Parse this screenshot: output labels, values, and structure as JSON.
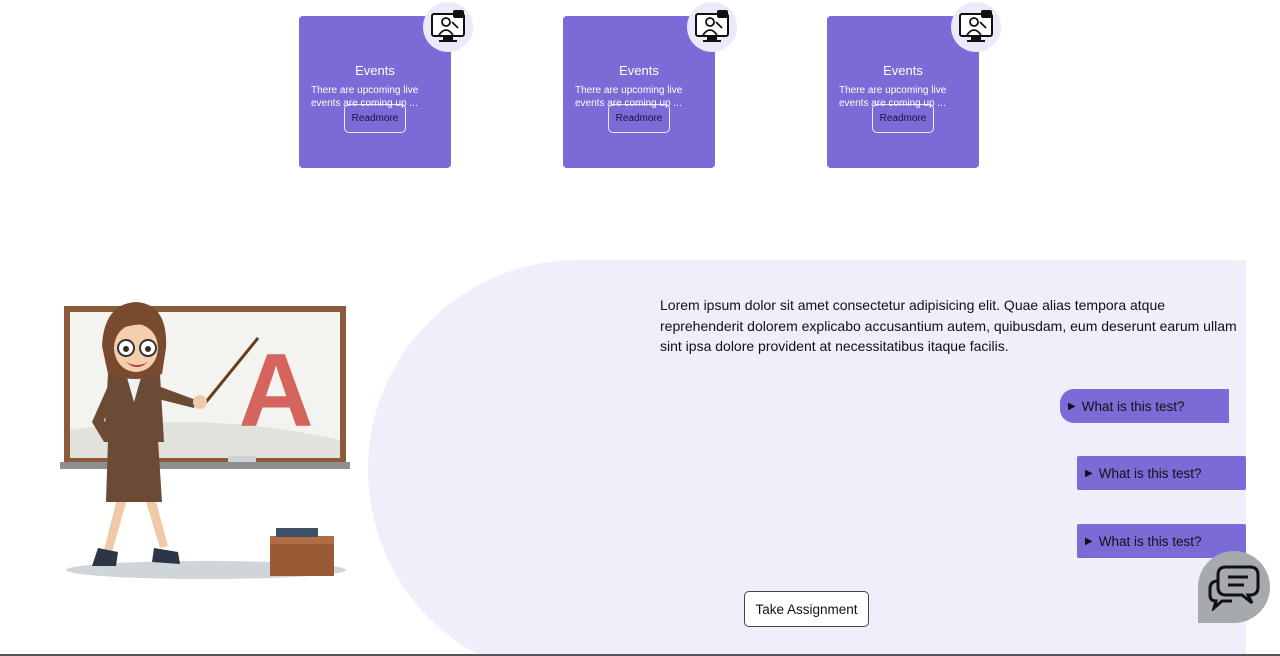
{
  "events": [
    {
      "title": "Events",
      "description": "There are upcoming live events are coming up ...",
      "button": "Readmore"
    },
    {
      "title": "Events",
      "description": "There are upcoming live events are coming up ...",
      "button": "Readmore"
    },
    {
      "title": "Events",
      "description": "There are upcoming live events are coming up ...",
      "button": "Readmore"
    }
  ],
  "intro_text": "Lorem ipsum dolor sit amet consectetur adipisicing elit. Quae alias tempora atque reprehenderit dolorem explicabo accusantium autem, quibusdam, eum deserunt earum ullam sint ipsa dolore provident at necessitatibus itaque facilis.",
  "faq": [
    {
      "marker": "▶",
      "question": "What is this test?"
    },
    {
      "marker": "▶",
      "question": "What is this test?"
    },
    {
      "marker": "▶",
      "question": "What is this test?"
    }
  ],
  "take_assignment_label": "Take Assignment",
  "illustration": {
    "board_letter": "A"
  },
  "icons": {
    "event_badge": "online-teacher-icon",
    "chat": "chat-bubble-icon"
  },
  "colors": {
    "accent": "#7b6bd6",
    "panel": "#efeefb",
    "chat_fab": "#a6a9ae"
  }
}
